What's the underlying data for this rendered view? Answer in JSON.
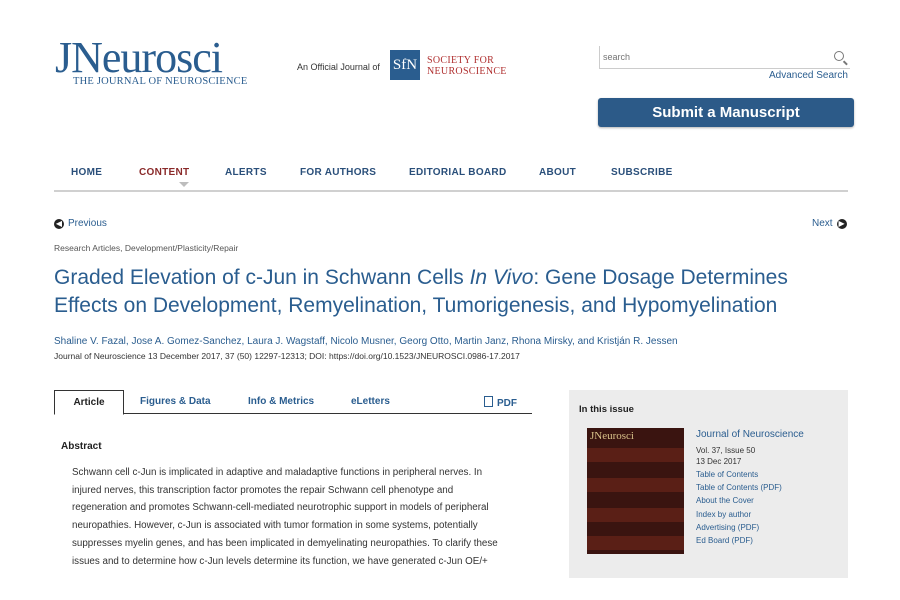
{
  "header": {
    "logo_main": "JNeurosci",
    "logo_sub": "THE JOURNAL OF NEUROSCIENCE",
    "official_text": "An Official Journal of",
    "sfn_mark": "SfN",
    "sfn_name_1": "Society for",
    "sfn_name_2": "Neuroscience",
    "search_placeholder": "search",
    "advanced_search": "Advanced Search",
    "submit_label": "Submit a Manuscript"
  },
  "nav": {
    "items": [
      "HOME",
      "CONTENT",
      "ALERTS",
      "FOR AUTHORS",
      "EDITORIAL BOARD",
      "ABOUT",
      "SUBSCRIBE"
    ],
    "active": "CONTENT"
  },
  "pager": {
    "previous": "Previous",
    "next": "Next"
  },
  "article": {
    "breadcrumb": "Research Articles, Development/Plasticity/Repair",
    "title_part1": "Graded Elevation of c-Jun in Schwann Cells ",
    "title_italic": "In Vivo",
    "title_part2": ": Gene Dosage Determines Effects on Development, Remyelination, Tumorigenesis, and Hypomyelination",
    "authors": "Shaline V. Fazal, Jose A. Gomez-Sanchez, Laura J. Wagstaff, Nicolo Musner, Georg Otto, Martin Janz, Rhona Mirsky, and Kristján R. Jessen",
    "citation": "Journal of Neuroscience 13 December 2017, 37 (50) 12297-12313; DOI: https://doi.org/10.1523/JNEUROSCI.0986-17.2017"
  },
  "tabs": {
    "article": "Article",
    "figures": "Figures & Data",
    "info": "Info & Metrics",
    "eletters": "eLetters",
    "pdf": "PDF"
  },
  "abstract": {
    "heading": "Abstract",
    "lines": [
      "Schwann cell c-Jun is implicated in adaptive and maladaptive functions in peripheral nerves. In",
      "injured nerves, this transcription factor promotes the repair Schwann cell phenotype and",
      "regeneration and promotes Schwann-cell-mediated neurotrophic support in models of peripheral",
      "neuropathies. However, c-Jun is associated with tumor formation in some systems, potentially",
      "suppresses myelin genes, and has been implicated in demyelinating neuropathies. To clarify these",
      "issues and to determine how c-Jun levels determine its function, we have generated c-Jun OE/+"
    ]
  },
  "sidebar": {
    "heading": "In this issue",
    "cover_title": "JNeurosci",
    "journal": "Journal of Neuroscience",
    "volume": "Vol. 37, Issue 50",
    "date": "13 Dec 2017",
    "links": [
      "Table of Contents",
      "Table of Contents (PDF)",
      "About the Cover",
      "Index by author",
      "Advertising (PDF)",
      "Ed Board (PDF)"
    ]
  }
}
